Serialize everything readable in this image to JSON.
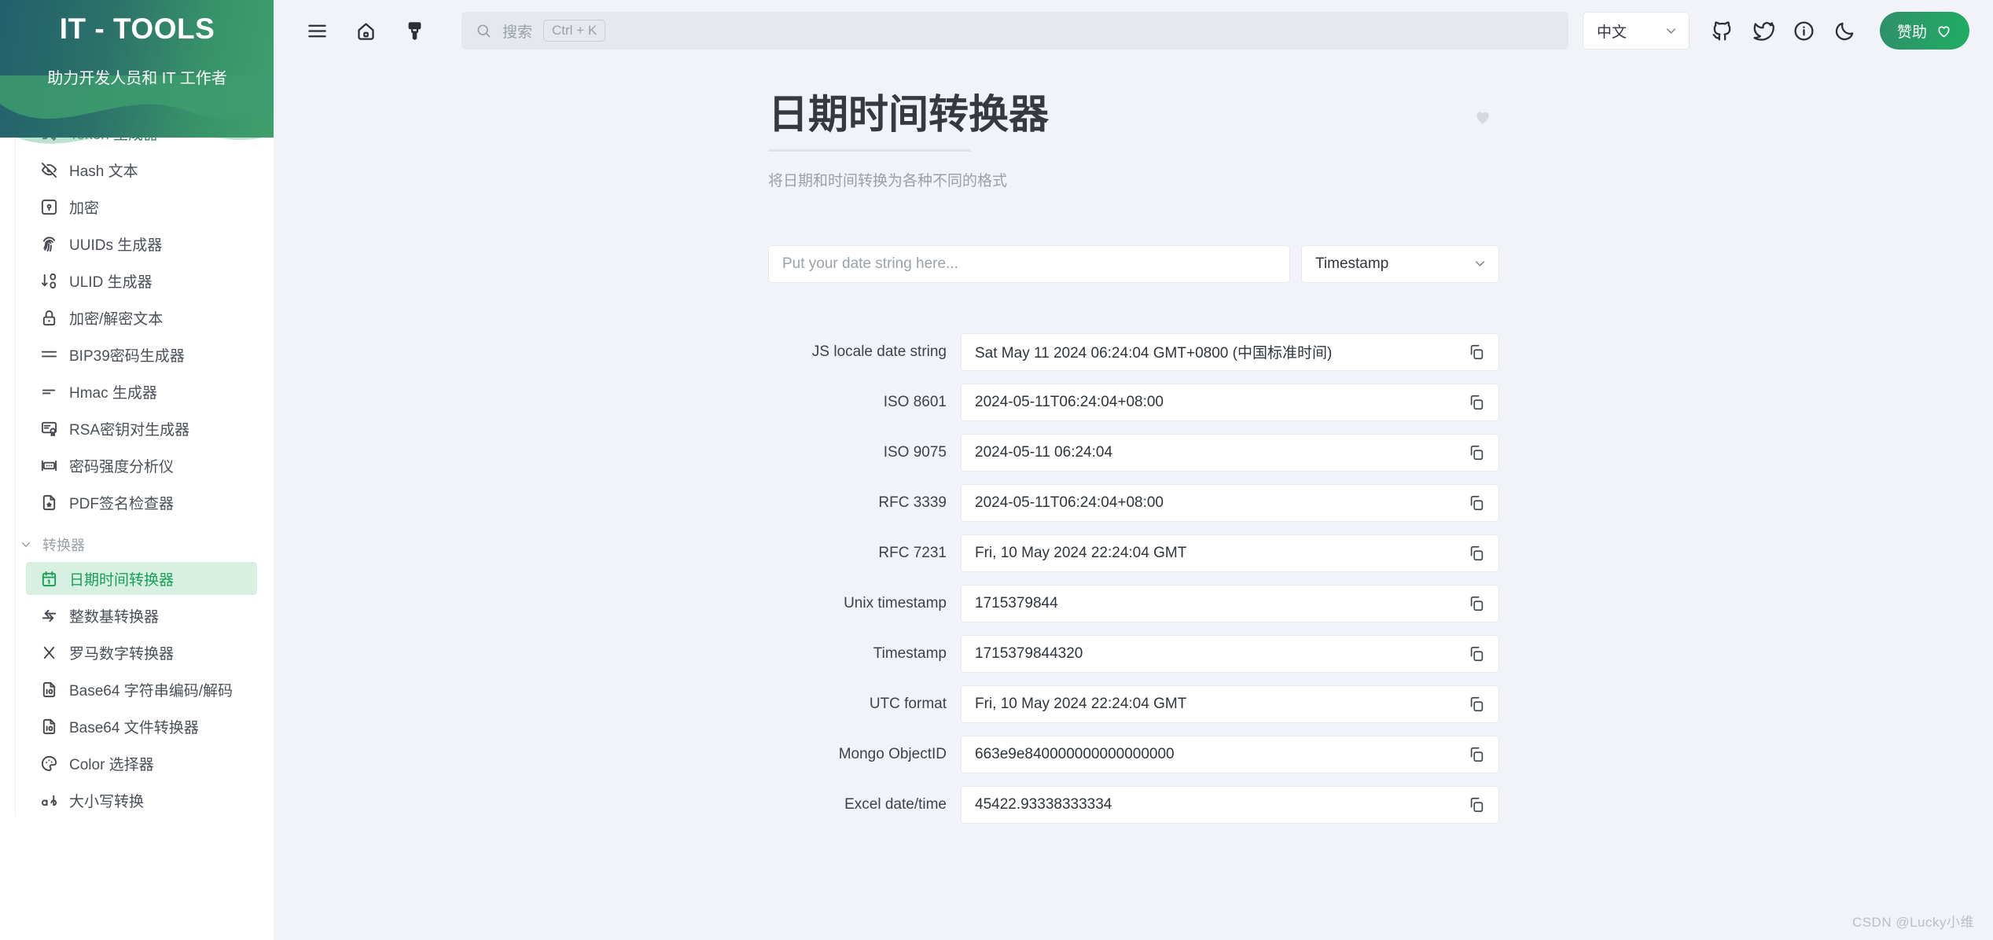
{
  "brand": {
    "title": "IT - TOOLS",
    "subtitle": "助力开发人员和 IT 工作者"
  },
  "sidebar": {
    "items_top": [
      {
        "label": "Token 生成器",
        "icon": "shuffle-icon",
        "partially_hidden": true
      },
      {
        "label": "Hash 文本",
        "icon": "eye-off-icon"
      },
      {
        "label": "加密",
        "icon": "lock-square-icon"
      },
      {
        "label": "UUIDs 生成器",
        "icon": "fingerprint-icon"
      },
      {
        "label": "ULID 生成器",
        "icon": "sort-numbers-icon"
      },
      {
        "label": "加密/解密文本",
        "icon": "padlock-icon"
      },
      {
        "label": "BIP39密码生成器",
        "icon": "lines-icon"
      },
      {
        "label": "Hmac 生成器",
        "icon": "short-lines-icon"
      },
      {
        "label": "RSA密钥对生成器",
        "icon": "certificate-icon"
      },
      {
        "label": "密码强度分析仪",
        "icon": "password-meter-icon"
      },
      {
        "label": "PDF签名检查器",
        "icon": "pdf-badge-icon"
      }
    ],
    "group": {
      "label": "转换器",
      "expanded": true,
      "items": [
        {
          "label": "日期时间转换器",
          "icon": "calendar-icon",
          "active": true
        },
        {
          "label": "整数基转换器",
          "icon": "arrows-exchange-icon"
        },
        {
          "label": "罗马数字转换器",
          "icon": "letter-x-icon"
        },
        {
          "label": "Base64 字符串编码/解码",
          "icon": "file-binary-icon"
        },
        {
          "label": "Base64 文件转换器",
          "icon": "file-binary-icon"
        },
        {
          "label": "Color 选择器",
          "icon": "palette-icon"
        },
        {
          "label": "大小写转换",
          "icon": "case-icon",
          "partially_hidden": true
        }
      ]
    },
    "accent_active_bg": "#d7f0e1",
    "accent_active_fg": "#18a058"
  },
  "topbar": {
    "menu_icon": "hamburger-menu-icon",
    "home_icon": "home-icon",
    "theme_icon": "paint-brush-icon",
    "search": {
      "placeholder": "搜索",
      "shortcut": "Ctrl + K",
      "icon": "search-icon"
    },
    "language": {
      "selected": "中文",
      "chevron": "chevron-down-icon"
    },
    "icons": [
      {
        "name": "github-icon"
      },
      {
        "name": "twitter-icon"
      },
      {
        "name": "info-icon"
      },
      {
        "name": "moon-icon"
      }
    ],
    "sponsor": {
      "label": "赞助",
      "icon": "heart-icon"
    }
  },
  "page": {
    "title": "日期时间转换器",
    "subtitle": "将日期和时间转换为各种不同的格式",
    "favorite_icon": "heart-filled-icon",
    "input": {
      "placeholder": "Put your date string here...",
      "value": ""
    },
    "format_select": {
      "selected": "Timestamp",
      "chevron": "chevron-down-icon"
    },
    "results": [
      {
        "label": "JS locale date string",
        "value": "Sat May 11 2024 06:24:04 GMT+0800 (中国标准时间)"
      },
      {
        "label": "ISO 8601",
        "value": "2024-05-11T06:24:04+08:00"
      },
      {
        "label": "ISO 9075",
        "value": "2024-05-11 06:24:04"
      },
      {
        "label": "RFC 3339",
        "value": "2024-05-11T06:24:04+08:00"
      },
      {
        "label": "RFC 7231",
        "value": "Fri, 10 May 2024 22:24:04 GMT"
      },
      {
        "label": "Unix timestamp",
        "value": "1715379844"
      },
      {
        "label": "Timestamp",
        "value": "1715379844320"
      },
      {
        "label": "UTC format",
        "value": "Fri, 10 May 2024 22:24:04 GMT"
      },
      {
        "label": "Mongo ObjectID",
        "value": "663e9e840000000000000000"
      },
      {
        "label": "Excel date/time",
        "value": "45422.93338333334"
      }
    ],
    "copy_icon": "copy-icon"
  },
  "watermark": "CSDN @Lucky小维",
  "colors": {
    "background": "#f1f3f8",
    "panel": "#ffffff",
    "brand_gradient_from": "#22606c",
    "brand_gradient_to": "#3fa06b",
    "accent_green": "#18a058",
    "text_primary": "#343a40",
    "text_muted": "#9aa0a8"
  }
}
